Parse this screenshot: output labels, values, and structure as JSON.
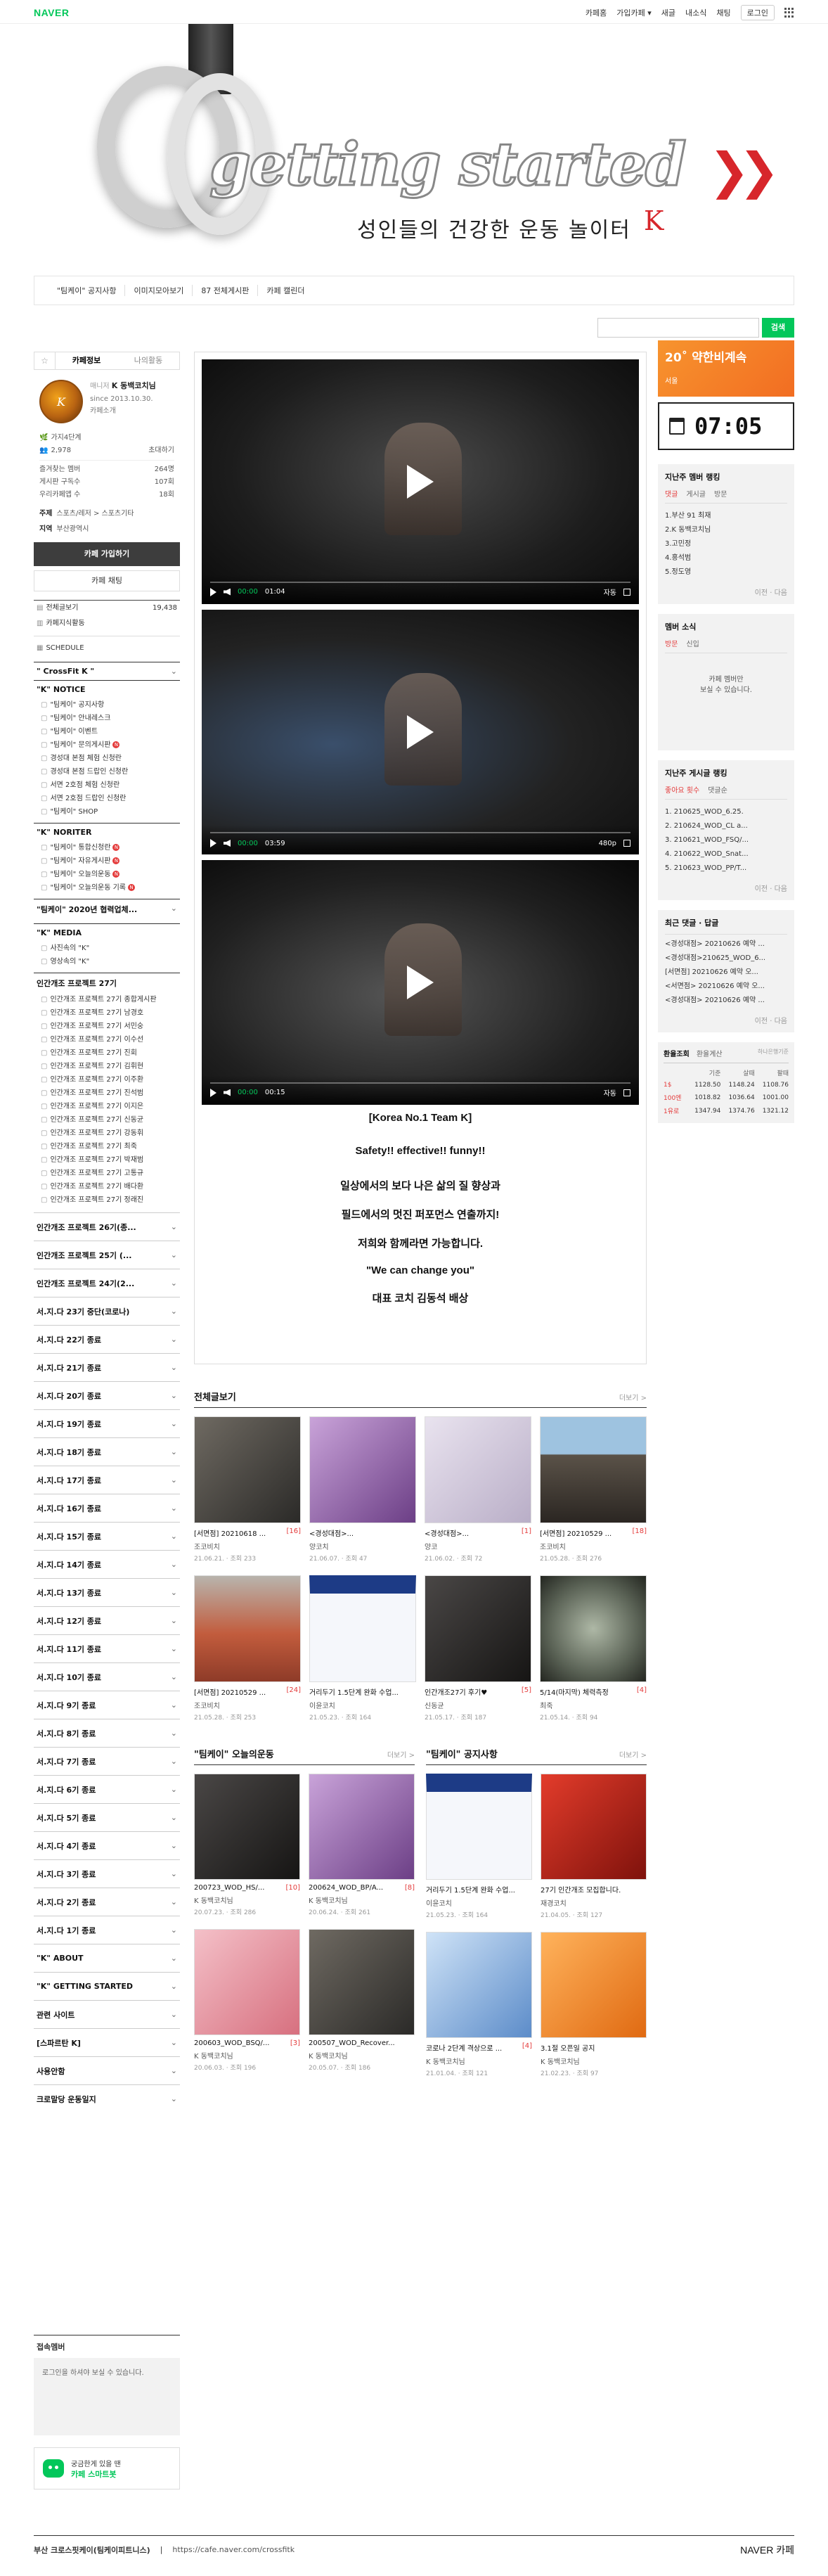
{
  "gnb": {
    "logo": "NAVER",
    "menu": [
      "카페홈",
      "가입카페",
      "새글",
      "내소식",
      "채팅"
    ],
    "login": "로그인"
  },
  "banner": {
    "title": "getting started",
    "subtitle": "성인들의 건강한 운동 놀이터",
    "k": "K"
  },
  "menubar": [
    "\"팀케이\" 공지사항",
    "이미지모아보기",
    "87 전체게시판",
    "카페 캘린더"
  ],
  "search": {
    "button": "검색"
  },
  "sidebar": {
    "tabs": {
      "star": "☆",
      "cafe_info": "카페정보",
      "my_activity": "나의활동"
    },
    "profile": {
      "role": "매니저",
      "manager": "K 동백코치님",
      "since": "since 2013.10.30.",
      "intro": "카페소개"
    },
    "stats": {
      "grade": "가지4단계",
      "members": "2,978",
      "members_unit": "초대하기",
      "favorite_label": "즐겨찾는 멤버",
      "favorite_value": "264명",
      "sub_label": "게시판 구독수",
      "sub_value": "107회",
      "rank_label": "우리카페앱 수",
      "rank_value": "18회"
    },
    "theme": {
      "label": "주제",
      "value": "스포츠/레저 > 스포츠기타"
    },
    "region": {
      "label": "지역",
      "value": "부산광역시"
    },
    "join_button": "카페 가입하기",
    "chat_button": "카페 채팅",
    "board_all": "전체글보기",
    "board_all_count": "19,438",
    "board_popular": "카페지식활동",
    "schedule": "SCHEDULE",
    "crossfit": "\" CrossFit K \"",
    "notice_group": "\"K\" NOTICE",
    "notice_items": [
      "\"팀케이\" 공지사항",
      "\"팀케이\" 안내레스크",
      "\"팀케이\" 이벤트",
      "\"팀케이\" 문의게시판",
      "경성대 본점 체험 신청란",
      "경성대 본점 드랍인 신청란",
      "서면 2호점 체험 신청란",
      "서면 2호점 드랍인 신청란",
      "\"팀케이\" SHOP"
    ],
    "noriter_group": "\"K\" NORITER",
    "noriter_items": [
      "\"팀케이\" 통합신청란",
      "\"팀케이\" 자유게시판",
      "\"팀케이\" 오늘의운동",
      "\"팀케이\" 오늘의운동 기록"
    ],
    "program_group": "\"팀케이\" 2020년 협력업체...",
    "media_group": "\"K\" MEDIA",
    "media_items": [
      "사진속의 \"K\"",
      "영상속의 \"K\""
    ],
    "project_group": "인간개조 프로젝트 27기",
    "project_items": [
      "인간개조 프로젝트 27기 종합게시판",
      "인간개조 프로젝트 27기 남경호",
      "인간개조 프로젝트 27기 서민숭",
      "인간개조 프로젝트 27기 이수선",
      "인간개조 프로젝트 27기 진회",
      "인간개조 프로젝트 27기 김휘현",
      "인간개조 프로젝트 27기 이주환",
      "인간개조 프로젝트 27기 진석범",
      "인간개조 프로젝트 27기 이지은",
      "인간개조 프로젝트 27기 신동균",
      "인간개조 프로젝트 27기 강동휘",
      "인간개조 프로젝트 27기 최죽",
      "인간개조 프로젝트 27기 박재범",
      "인간개조 프로젝트 27기 고통규",
      "인간개조 프로젝트 27기 배다환",
      "인간개조 프로젝트 27기 정래진"
    ],
    "collapsed": [
      "인간개조 프로젝트 26기(종...",
      "인간개조 프로젝트 25기 (...",
      "인간개조 프로젝트 24기(2...",
      "서.지.다 23기 중단(코로나)",
      "서.지.다 22기 종료",
      "서.지.다 21기 종료",
      "서.지.다 20기 종료",
      "서.지.다 19기 종료",
      "서.지.다 18기 종료",
      "서.지.다 17기 종료",
      "서.지.다 16기 종료",
      "서.지.다 15기 종료",
      "서.지.다 14기 종료",
      "서.지.다 13기 종료",
      "서.지.다 12기 종료",
      "서.지.다 11기 종료",
      "서.지.다 10기 종료",
      "서.지.다 9기 종료",
      "서.지.다 8기 종료",
      "서.지.다 7기 종료",
      "서.지.다 6기 종료",
      "서.지.다 5기 종료",
      "서.지.다 4기 종료",
      "서.지.다 3기 종료",
      "서.지.다 2기 종료",
      "서.지.다 1기 종료",
      "\"K\" ABOUT",
      "\"K\" GETTING STARTED",
      "관련 사이트",
      "[스파르탄 K]",
      "사용안함",
      "크로말당 운동일지"
    ],
    "member_box_title": "접속멤버",
    "member_box_text": "로그인을 하셔야 보실 수 있습니다.",
    "smart_line1": "궁금한게 있을 땐",
    "smart_line2": "카페 스마트봇"
  },
  "videos": [
    {
      "cur": "00:00",
      "dur": "01:04",
      "auto": "자동"
    },
    {
      "cur": "00:00",
      "dur": "03:59",
      "auto": "480p"
    },
    {
      "cur": "00:00",
      "dur": "00:15",
      "auto": "자동"
    }
  ],
  "post_text": [
    "[Korea No.1 Team K]",
    "Safety!! effective!! funny!!",
    "일상에서의 보다 나은 삶의 질 향상과",
    "필드에서의 멋진 퍼포먼스 연출까지!",
    "저희와 함께라면 가능합니다.",
    "\"We can change you\"",
    "대표 코치 김동석 배상"
  ],
  "album_all": {
    "title": "전체글보기",
    "more": "더보기 >",
    "items": [
      {
        "title": "[서면점] 20210618 ...",
        "cnt": "[16]",
        "writer": "조코비치",
        "meta": "21.06.21. · 조회 233",
        "thumb": "t-gym"
      },
      {
        "title": "<경성대점>...",
        "cnt": "",
        "writer": "양코치",
        "meta": "21.06.07. · 조회 47",
        "thumb": "t-purple"
      },
      {
        "title": "<경성대점>...",
        "cnt": "[1]",
        "writer": "양코",
        "meta": "21.06.02. · 조회 72",
        "thumb": "t-paper"
      },
      {
        "title": "[서면점] 20210529 ...",
        "cnt": "[18]",
        "writer": "조코비치",
        "meta": "21.05.28. · 조회 276",
        "thumb": "t-crowd"
      },
      {
        "title": "[서면점] 20210529 ...",
        "cnt": "[24]",
        "writer": "조코비치",
        "meta": "21.05.28. · 조회 253",
        "thumb": "t-track"
      },
      {
        "title": "거리두기 1.5단계 완화 수업...",
        "cnt": "",
        "writer": "이윤코치",
        "meta": "21.05.23. · 조회 164",
        "thumb": "t-poster"
      },
      {
        "title": "인간개조27기 후기♥",
        "cnt": "[5]",
        "writer": "신동균",
        "meta": "21.05.17. · 조회 187",
        "thumb": "t-dark"
      },
      {
        "title": "5/14(마지막) 체력측정",
        "cnt": "[4]",
        "writer": "최죽",
        "meta": "21.05.14. · 조회 94",
        "thumb": "t-watch"
      }
    ]
  },
  "album_wod": {
    "title": "\"팀케이\" 오늘의운동",
    "more": "더보기 >",
    "items": [
      {
        "title": "200723_WOD_HS/...",
        "cnt": "[10]",
        "writer": "K 동백코치님",
        "meta": "20.07.23. · 조회 286",
        "thumb": "t-dark"
      },
      {
        "title": "200624_WOD_BP/A...",
        "cnt": "[8]",
        "writer": "K 동백코치님",
        "meta": "20.06.24. · 조회 261",
        "thumb": "t-purple"
      },
      {
        "title": "200603_WOD_BSQ/...",
        "cnt": "[3]",
        "writer": "K 동백코치님",
        "meta": "20.06.03. · 조회 196",
        "thumb": "t-pink"
      },
      {
        "title": "200507_WOD_Recover...",
        "cnt": "",
        "writer": "K 동백코치님",
        "meta": "20.05.07. · 조회 186",
        "thumb": "t-gym"
      }
    ]
  },
  "album_notice": {
    "title": "\"팀케이\" 공지사항",
    "more": "더보기 >",
    "items": [
      {
        "title": "거리두기 1.5단계 완화 수업...",
        "cnt": "",
        "writer": "이윤코치",
        "meta": "21.05.23. · 조회 164",
        "thumb": "t-poster"
      },
      {
        "title": "27기 인간개조 모집합니다.",
        "cnt": "",
        "writer": "재경코치",
        "meta": "21.04.05. · 조회 127",
        "thumb": "t-red"
      },
      {
        "title": "코로나 2단계 격상으로 ...",
        "cnt": "[4]",
        "writer": "K 동백코치님",
        "meta": "21.01.04. · 조회 121",
        "thumb": "t-blue"
      },
      {
        "title": "3.1절 오픈일 공지",
        "cnt": "",
        "writer": "K 동백코치님",
        "meta": "21.02.23. · 조회 97",
        "thumb": "t-orange"
      }
    ]
  },
  "right": {
    "ad_big": "20˚ 약한비계속",
    "ad_small": "서울",
    "time": "07:05",
    "rank_title": "지난주 멤버 랭킹",
    "rank_tabs": [
      "댓글",
      "게시글",
      "방문"
    ],
    "rank_items": [
      "1.부산 91 최재",
      "2.K 동백코치님",
      "3.고민정",
      "4.홍석범",
      "5.정도영"
    ],
    "pager": "이전 · 다음",
    "news_title": "멤버 소식",
    "news_tabs": [
      "방문",
      "신입"
    ],
    "news_empty": "카페 멤버만\n보실 수 있습니다.",
    "post_rank_title": "지난주 게시글 랭킹",
    "post_rank_tabs": [
      "좋아요 횟수",
      "댓글순"
    ],
    "post_rank_items": [
      "1. 210625_WOD_6.25.",
      "2. 210624_WOD_CL a...",
      "3. 210621_WOD_FSQ/...",
      "4. 210622_WOD_Snat...",
      "5. 210623_WOD_PP/T..."
    ],
    "recent_title": "최근 댓글 · 답글",
    "recent_items": [
      "<경성대점> 20210626 예약 ...",
      "<경성대점>210625_WOD_6...",
      "[서면점] 20210626 예약 오...",
      "<서면점> 20210626 예약 오...",
      "<경성대점> 20210626 예약 ..."
    ],
    "rate_tabs": [
      "환율조회",
      "환율계산",
      "하나은행기준"
    ],
    "rate_headers": [
      "",
      "기준",
      "살때",
      "팔때"
    ],
    "rates": [
      {
        "cur": "1$",
        "base": "1128.50",
        "buy": "1148.24",
        "sell": "1108.76"
      },
      {
        "cur": "100엔",
        "base": "1018.82",
        "buy": "1036.64",
        "sell": "1001.00"
      },
      {
        "cur": "1유로",
        "base": "1347.94",
        "buy": "1374.76",
        "sell": "1321.12"
      }
    ]
  },
  "footer": {
    "name": "부산 크로스핏케이(팀케이피트니스)",
    "url": "https://cafe.naver.com/crossfitk",
    "brand": "NAVER",
    "brand_sub": "카페"
  }
}
